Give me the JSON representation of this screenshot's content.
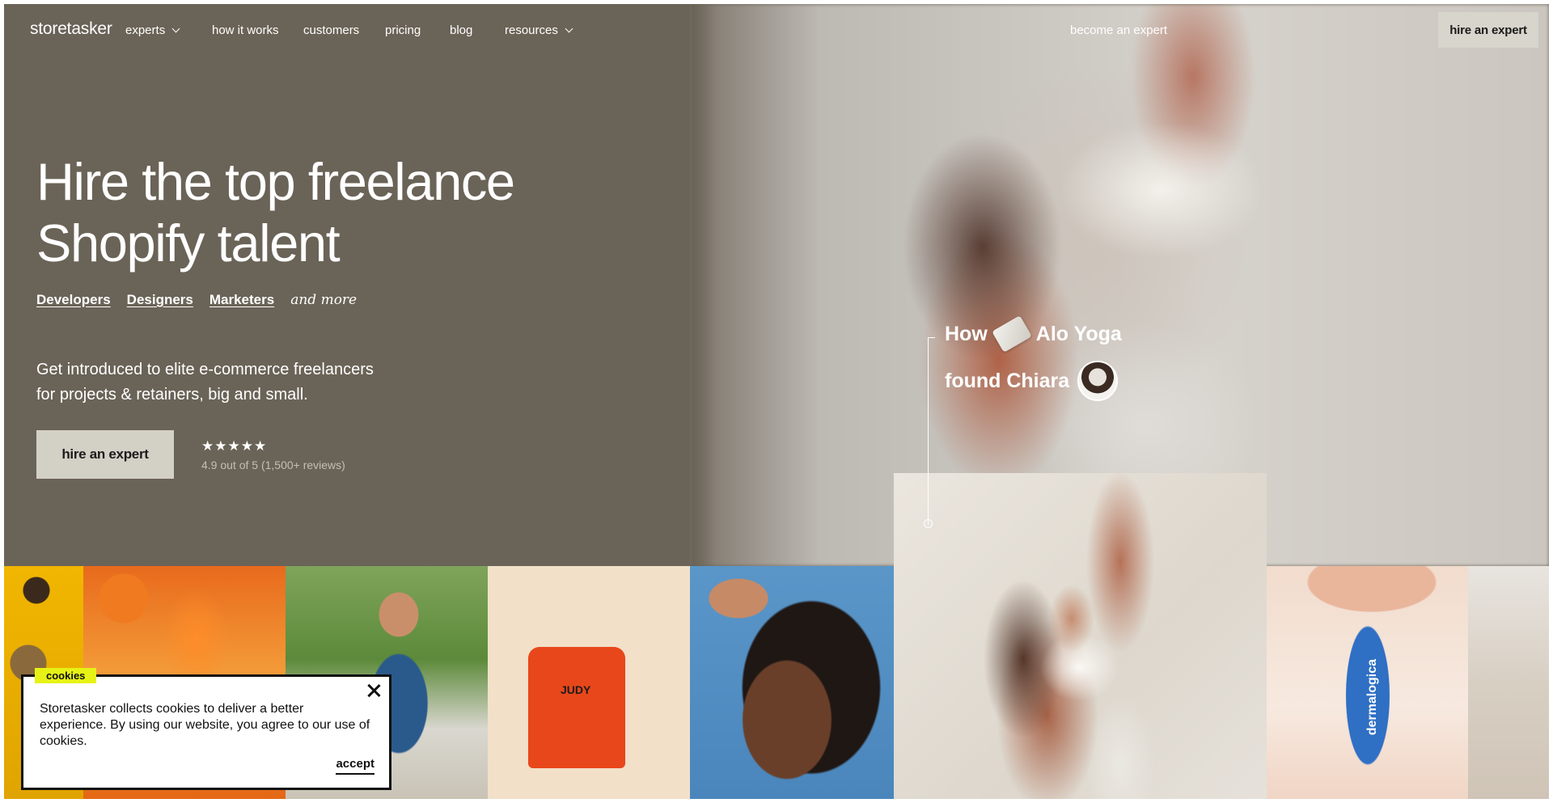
{
  "nav": {
    "logo": "storetasker",
    "links": [
      {
        "label": "experts",
        "has_dropdown": true
      },
      {
        "label": "how it works"
      },
      {
        "label": "customers"
      },
      {
        "label": "pricing"
      },
      {
        "label": "blog"
      },
      {
        "label": "resources",
        "has_dropdown": true
      }
    ],
    "become_expert": "become an expert",
    "cta": "hire an expert"
  },
  "hero": {
    "headline_line1": "Hire the top freelance",
    "headline_line2": "Shopify talent",
    "categories": [
      "Developers",
      "Designers",
      "Marketers"
    ],
    "categories_more": "and more",
    "subtext_line1": "Get introduced to elite e-commerce freelancers",
    "subtext_line2": "for projects & retainers, big and small.",
    "cta": "hire an expert",
    "stars": "★★★★★",
    "rating_text": "4.9 out of 5 (1,500+ reviews)"
  },
  "story": {
    "word_how": "How",
    "brand": "Alo Yoga",
    "found": "found Chiara"
  },
  "tiles": {
    "bag_label": "JUDY",
    "product_label": "dermalogica"
  },
  "cookie": {
    "tag": "cookies",
    "text": "Storetasker collects cookies to deliver a better experience. By using our website, you agree to our use of cookies.",
    "accept": "accept"
  },
  "colors": {
    "hero_bg": "#6a6357",
    "cta_bg": "#d3d0c6",
    "cookie_tag": "#e6f215"
  }
}
